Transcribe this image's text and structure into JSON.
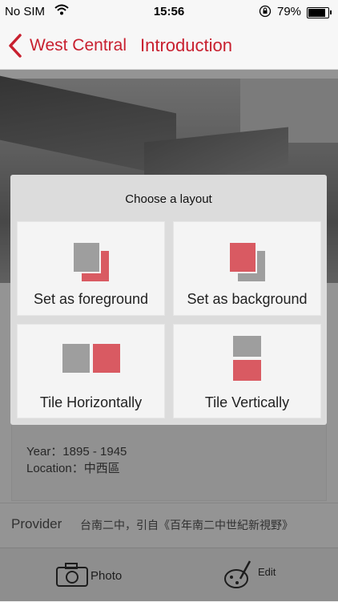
{
  "status_bar": {
    "carrier": "No SIM",
    "time": "15:56",
    "battery": "79%",
    "battery_level": 0.79
  },
  "nav": {
    "back_label": "West Central",
    "title": "Introduction"
  },
  "info": {
    "year": "Year：1895 - 1945",
    "location": "Location：中西區"
  },
  "provider": {
    "label": "Provider",
    "value": "台南二中，引自《百年南二中世紀新視野》"
  },
  "toolbar": {
    "photo_label": "Photo",
    "edit_label": "Edit"
  },
  "dialog": {
    "title": "Choose a layout",
    "options": [
      {
        "label": "Set as foreground",
        "icon": "foreground-layout-icon"
      },
      {
        "label": "Set as background",
        "icon": "background-layout-icon"
      },
      {
        "label": "Tile Horizontally",
        "icon": "tile-horizontal-icon"
      },
      {
        "label": "Tile Vertically",
        "icon": "tile-vertical-icon"
      }
    ]
  },
  "colors": {
    "accent": "#c8202f",
    "tile_red": "#d95a62",
    "tile_gray": "#9e9e9e"
  }
}
